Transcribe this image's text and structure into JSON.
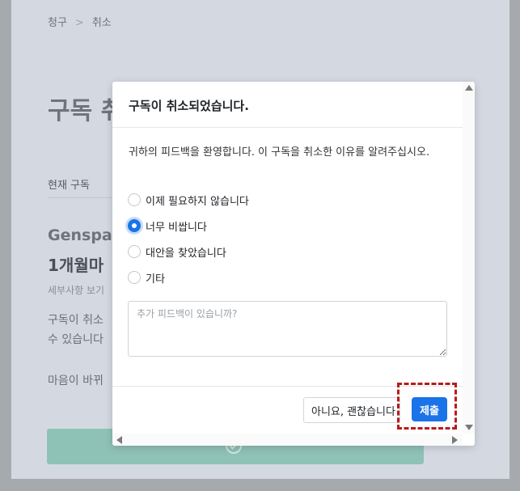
{
  "breadcrumb": {
    "parent": "청구",
    "separator": ">",
    "current": "취소"
  },
  "page": {
    "title": "구독 취",
    "current_label": "현재 구독",
    "plan_name": "Genspark",
    "plan_price": "1개월마",
    "details_link": "세부사항 보기",
    "cancel_notice_line1": "구독이 취소",
    "cancel_notice_line2": "수 있습니다",
    "change_mind": "마음이 바뀌"
  },
  "modal": {
    "title": "구독이 취소되었습니다.",
    "prompt": "귀하의 피드백을 환영합니다. 이 구독을 취소한 이유를 알려주십시오.",
    "options": [
      {
        "label": "이제 필요하지 않습니다",
        "checked": false
      },
      {
        "label": "너무 비쌉니다",
        "checked": true
      },
      {
        "label": "대안을 찾았습니다",
        "checked": false
      },
      {
        "label": "기타",
        "checked": false
      }
    ],
    "feedback_placeholder": "추가 피드백이 있습니까?",
    "no_thanks_label": "아니요, 괜찮습니다",
    "submit_label": "제출"
  },
  "colors": {
    "accent": "#1a73e8",
    "highlight": "#b71c1c",
    "resubscribe_button": "#8fc2b7"
  }
}
